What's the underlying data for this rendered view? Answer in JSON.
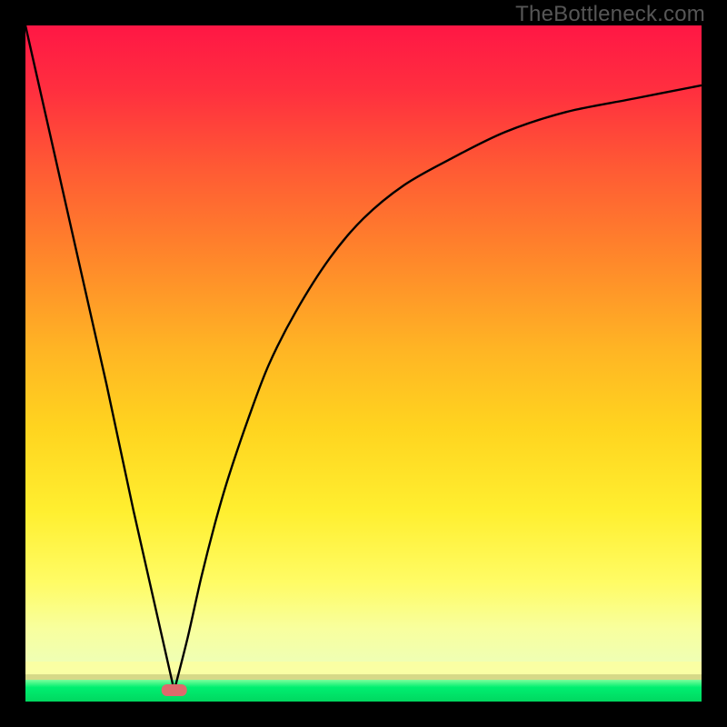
{
  "watermark": "TheBottleneck.com",
  "colors": {
    "frame": "#000000",
    "curve": "#000000",
    "bottom_band_main": "#00e667",
    "bottom_glow": "#fcffa0",
    "marker_fill": "#dd6a6c",
    "gradient_stops": [
      {
        "offset": 0.0,
        "color": "#ff1745"
      },
      {
        "offset": 0.1,
        "color": "#ff2f3f"
      },
      {
        "offset": 0.22,
        "color": "#ff5a34"
      },
      {
        "offset": 0.35,
        "color": "#ff842b"
      },
      {
        "offset": 0.5,
        "color": "#ffb524"
      },
      {
        "offset": 0.62,
        "color": "#ffd41f"
      },
      {
        "offset": 0.75,
        "color": "#ffef30"
      },
      {
        "offset": 0.86,
        "color": "#fffc66"
      },
      {
        "offset": 0.93,
        "color": "#f8ff9e"
      },
      {
        "offset": 1.0,
        "color": "#ecffbc"
      }
    ]
  },
  "chart_data": {
    "type": "line",
    "title": "",
    "xlabel": "",
    "ylabel": "",
    "xlim": [
      0,
      100
    ],
    "ylim": [
      0,
      100
    ],
    "note": "V-shaped bottleneck curve. Left branch is a straight line from top-left down to the minimum; right branch is a concave-increasing curve from the minimum toward the top-right, flattening out. Values estimated from pixel positions (no axis ticks present).",
    "minimum_x": 22,
    "minimum_y": 0,
    "series": [
      {
        "name": "left-branch",
        "x": [
          0,
          4,
          8,
          12,
          16,
          20,
          22
        ],
        "values": [
          100,
          82,
          64,
          46,
          27,
          9,
          0
        ]
      },
      {
        "name": "right-branch",
        "x": [
          22,
          24,
          26,
          28,
          30,
          33,
          36,
          40,
          45,
          50,
          56,
          63,
          71,
          80,
          90,
          100
        ],
        "values": [
          0,
          8,
          17,
          25,
          32,
          41,
          49,
          57,
          65,
          71,
          76,
          80,
          84,
          87,
          89,
          91
        ]
      }
    ],
    "marker": {
      "x": 22,
      "y": 0,
      "shape": "rounded-rect"
    }
  }
}
